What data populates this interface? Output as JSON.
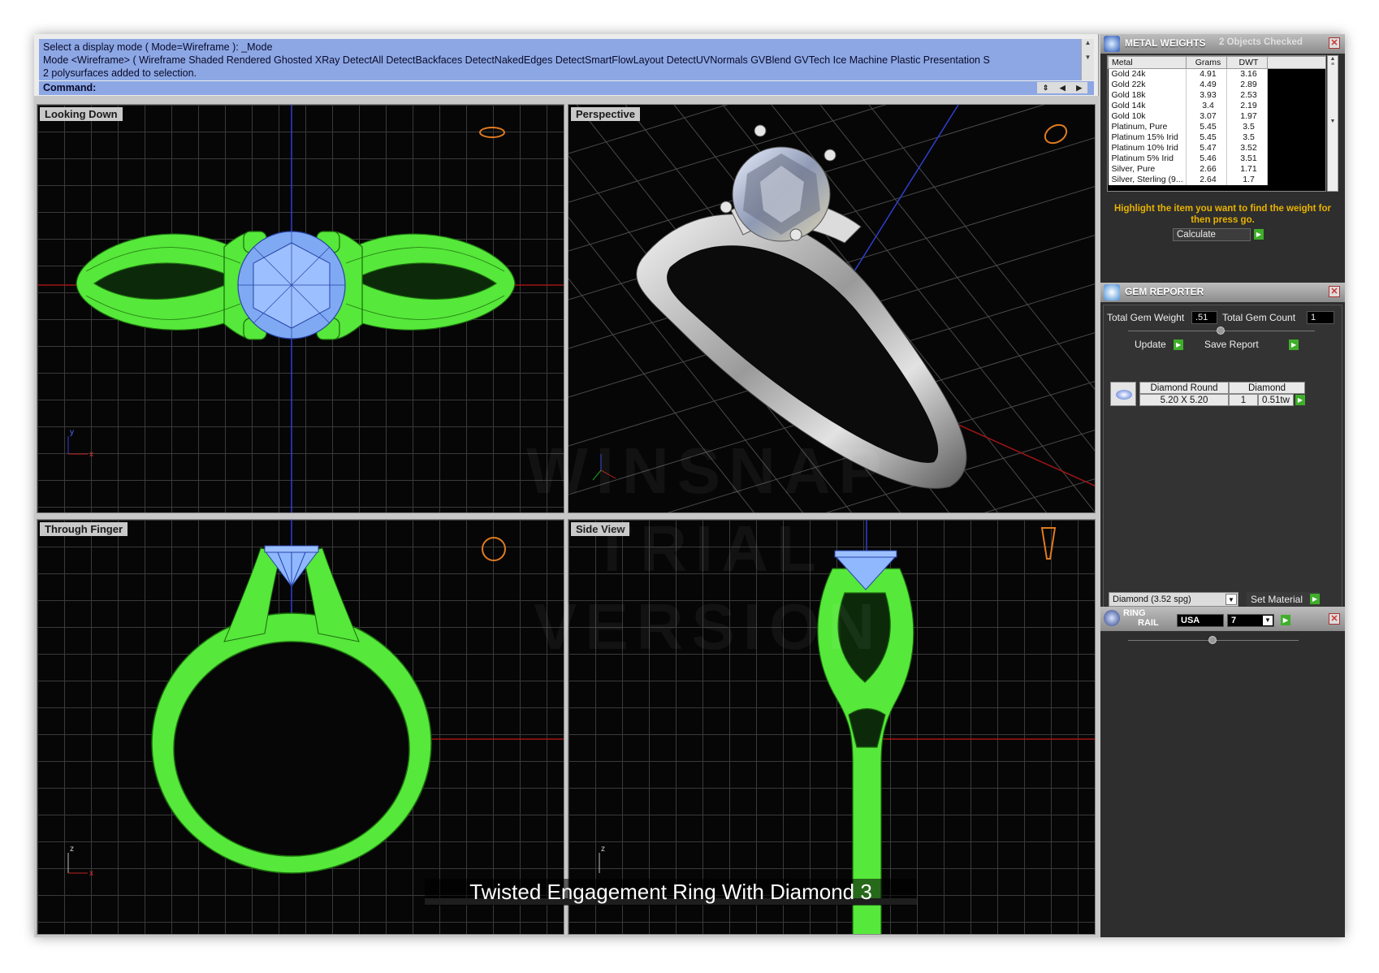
{
  "command": {
    "history": [
      "Select a display mode ( Mode=Wireframe ): _Mode",
      "Mode <Wireframe> ( Wireframe  Shaded  Rendered  Ghosted  XRay  DetectAll  DetectBackfaces  DetectNakedEdges  DetectSmartFlowLayout  DetectUVNormals  GVBlend  GVTech  Ice  Machine  Plastic  Presentation  S",
      "2 polysurfaces added to selection."
    ],
    "prompt": "Command:"
  },
  "viewports": {
    "top_left": "Looking Down",
    "top_right": "Perspective",
    "bottom_left": "Through Finger",
    "bottom_right": "Side View"
  },
  "axes": {
    "x": "x",
    "y": "y",
    "z": "z"
  },
  "caption": "Twisted Engagement Ring With Diamond 3",
  "watermark": [
    "WINSNAP",
    "TRIAL VERSION"
  ],
  "metal_weights": {
    "title": "METAL WEIGHTS",
    "status": "2 Objects Checked",
    "columns": [
      "Metal",
      "Grams",
      "DWT"
    ],
    "rows": [
      [
        "Gold 24k",
        "4.91",
        "3.16"
      ],
      [
        "Gold 22k",
        "4.49",
        "2.89"
      ],
      [
        "Gold 18k",
        "3.93",
        "2.53"
      ],
      [
        "Gold 14k",
        "3.4",
        "2.19"
      ],
      [
        "Gold 10k",
        "3.07",
        "1.97"
      ],
      [
        "Platinum, Pure",
        "5.45",
        "3.5"
      ],
      [
        "Platinum 15% Irid",
        "5.45",
        "3.5"
      ],
      [
        "Platinum 10% Irid",
        "5.47",
        "3.52"
      ],
      [
        "Platinum 5% Irid",
        "5.46",
        "3.51"
      ],
      [
        "Silver, Pure",
        "2.66",
        "1.71"
      ],
      [
        "Silver, Sterling (9...",
        "2.64",
        "1.7"
      ]
    ],
    "hint": "Highlight the item you want to find the weight for then press go.",
    "calculate_label": "Calculate"
  },
  "gem_reporter": {
    "title": "GEM REPORTER",
    "total_weight_label": "Total Gem Weight",
    "total_weight_value": ".51",
    "total_count_label": "Total Gem Count",
    "total_count_value": "1",
    "update_label": "Update",
    "save_report_label": "Save Report",
    "gem": {
      "shape": "Diamond Round",
      "type": "Diamond",
      "size": "5.20 X 5.20",
      "count": "1",
      "weight": "0.51tw"
    },
    "material_select": "Diamond     (3.52 spg)",
    "set_material_label": "Set Material"
  },
  "ring_rail": {
    "title_line1": "RING",
    "title_line2": "RAIL",
    "country": "USA",
    "size": "7"
  },
  "colors": {
    "wire_green": "#5cf23c",
    "gem_blue": "#8fb8ff",
    "command_blue": "#8ca7e4",
    "hint_yellow": "#e8b200",
    "accept_green": "#3fae2a"
  }
}
